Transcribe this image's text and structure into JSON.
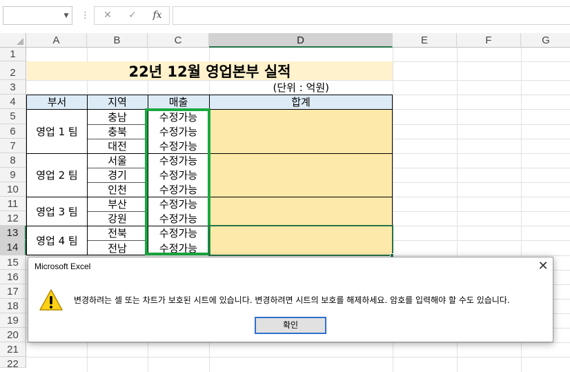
{
  "formula_bar": {
    "name_box_value": "",
    "cancel_icon": "✕",
    "enter_icon": "✓",
    "fx_icon": "fx",
    "formula_value": ""
  },
  "columns": [
    "A",
    "B",
    "C",
    "D",
    "E",
    "F",
    "G"
  ],
  "rows": [
    "1",
    "2",
    "3",
    "4",
    "5",
    "6",
    "7",
    "8",
    "9",
    "10",
    "11",
    "12",
    "13",
    "14",
    "15",
    "16",
    "17",
    "18",
    "19",
    "20",
    "21",
    "22"
  ],
  "sheet": {
    "title": "22년 12월 영업본부 실적",
    "unit": "(단위 : 억원)",
    "headers": {
      "dept": "부서",
      "region": "지역",
      "sales": "매출",
      "total": "합계"
    },
    "teams": [
      "영업 1 팀",
      "영업 2 팀",
      "영업 3 팀",
      "영업 4 팀"
    ],
    "regions": [
      "충남",
      "충북",
      "대전",
      "서울",
      "경기",
      "인천",
      "부산",
      "강원",
      "전북",
      "전남"
    ],
    "sales_values": [
      "수정가능",
      "수정가능",
      "수정가능",
      "수정가능",
      "수정가능",
      "수정가능",
      "수정가능",
      "수정가능",
      "수정가능",
      "수정가능"
    ]
  },
  "dialog": {
    "title": "Microsoft Excel",
    "close_icon": "✕",
    "icon": "warning-icon",
    "message": "변경하려는 셀 또는 차트가 보호된 시트에 있습니다. 변경하려면 시트의 보호를 해제하세요. 암호를 입력해야 할 수도 있습니다.",
    "ok_label": "확인"
  }
}
